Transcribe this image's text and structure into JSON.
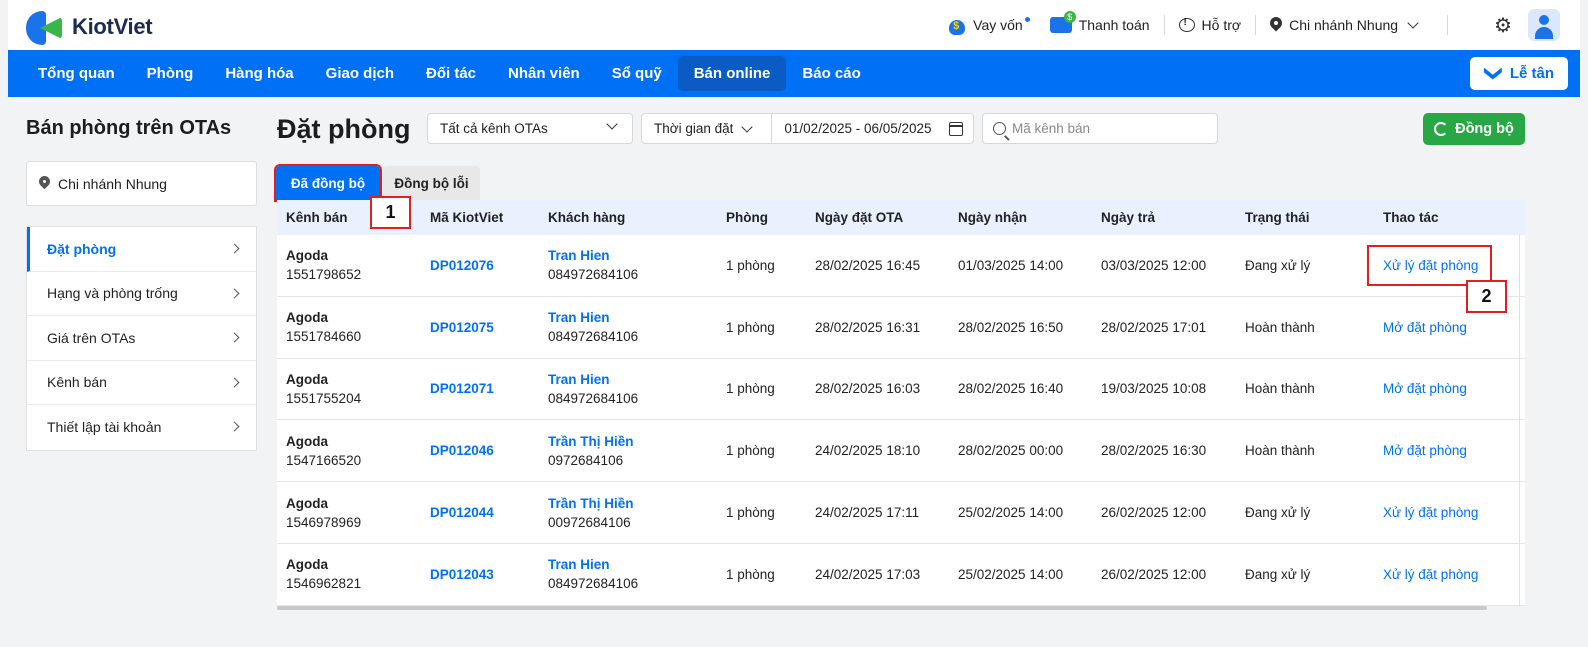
{
  "brand": {
    "name": "KiotViet"
  },
  "header": {
    "loan_label": "Vay vốn",
    "payment_label": "Thanh toán",
    "support_label": "Hỗ trợ",
    "branch_label": "Chi nhánh Nhung"
  },
  "nav": {
    "items": [
      "Tổng quan",
      "Phòng",
      "Hàng hóa",
      "Giao dịch",
      "Đối tác",
      "Nhân viên",
      "Sổ quỹ",
      "Bán online",
      "Báo cáo"
    ],
    "active": "Bán online",
    "reception_label": "Lễ tân"
  },
  "sidebar": {
    "title": "Bán phòng trên OTAs",
    "branch": "Chi nhánh Nhung",
    "items": [
      "Đặt phòng",
      "Hạng và phòng trống",
      "Giá trên OTAs",
      "Kênh bán",
      "Thiết lập tài khoản"
    ],
    "active": "Đặt phòng"
  },
  "main": {
    "title": "Đặt phòng",
    "ota_filter": "Tất cả kênh OTAs",
    "time_filter": "Thời gian đặt",
    "date_range": "01/02/2025 - 06/05/2025",
    "search_placeholder": "Mã kênh bán",
    "sync_label": "Đồng bộ"
  },
  "tabs": [
    "Đã đồng bộ",
    "Đồng bộ lỗi"
  ],
  "callouts": [
    "1",
    "2"
  ],
  "table": {
    "columns": [
      "Kênh bán",
      "Mã KiotViet",
      "Khách hàng",
      "Phòng",
      "Ngày đặt OTA",
      "Ngày nhận",
      "Ngày trả",
      "Trạng thái",
      "Thao tác"
    ],
    "rows": [
      {
        "channel": "Agoda",
        "channel_id": "1551798652",
        "code": "DP012076",
        "customer": "Tran Hien",
        "phone": "084972684106",
        "rooms": "1 phòng",
        "ota_date": "28/02/2025 16:45",
        "checkin": "01/03/2025 14:00",
        "checkout": "03/03/2025 12:00",
        "status": "Đang xử lý",
        "action": "Xử lý đặt phòng"
      },
      {
        "channel": "Agoda",
        "channel_id": "1551784660",
        "code": "DP012075",
        "customer": "Tran Hien",
        "phone": "084972684106",
        "rooms": "1 phòng",
        "ota_date": "28/02/2025 16:31",
        "checkin": "28/02/2025 16:50",
        "checkout": "28/02/2025 17:01",
        "status": "Hoàn thành",
        "action": "Mở đặt phòng"
      },
      {
        "channel": "Agoda",
        "channel_id": "1551755204",
        "code": "DP012071",
        "customer": "Tran Hien",
        "phone": "084972684106",
        "rooms": "1 phòng",
        "ota_date": "28/02/2025 16:03",
        "checkin": "28/02/2025 16:40",
        "checkout": "19/03/2025 10:08",
        "status": "Hoàn thành",
        "action": "Mở đặt phòng"
      },
      {
        "channel": "Agoda",
        "channel_id": "1547166520",
        "code": "DP012046",
        "customer": "Trần Thị Hiền",
        "phone": "0972684106",
        "rooms": "1 phòng",
        "ota_date": "24/02/2025 18:10",
        "checkin": "28/02/2025 00:00",
        "checkout": "28/02/2025 16:30",
        "status": "Hoàn thành",
        "action": "Mở đặt phòng"
      },
      {
        "channel": "Agoda",
        "channel_id": "1546978969",
        "code": "DP012044",
        "customer": "Trần Thị Hiền",
        "phone": "00972684106",
        "rooms": "1 phòng",
        "ota_date": "24/02/2025 17:11",
        "checkin": "25/02/2025 14:00",
        "checkout": "26/02/2025 12:00",
        "status": "Đang xử lý",
        "action": "Xử lý đặt phòng"
      },
      {
        "channel": "Agoda",
        "channel_id": "1546962821",
        "code": "DP012043",
        "customer": "Tran Hien",
        "phone": "084972684106",
        "rooms": "1 phòng",
        "ota_date": "24/02/2025 17:03",
        "checkin": "25/02/2025 14:00",
        "checkout": "26/02/2025 12:00",
        "status": "Đang xử lý",
        "action": "Xử lý đặt phòng"
      }
    ]
  },
  "colors": {
    "primary": "#0070f4",
    "success": "#28a745",
    "annotation": "#e02020"
  }
}
